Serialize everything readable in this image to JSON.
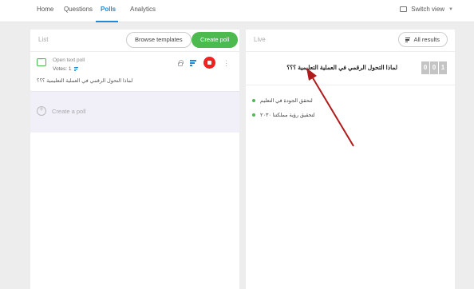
{
  "nav": {
    "tabs": [
      "Home",
      "Questions",
      "Polls",
      "Analytics"
    ],
    "active": "Polls",
    "switch_view": "Switch view"
  },
  "list_panel": {
    "title": "List",
    "browse_templates": "Browse templates",
    "create_poll": "Create poll",
    "poll": {
      "type": "Open text poll",
      "votes": "Votes: 1",
      "question": "لماذا التحول الرقمي في العملية التعليمية ؟؟؟"
    },
    "create_row_label": "Create a poll"
  },
  "live_panel": {
    "title": "Live",
    "all_results": "All results",
    "question": "لماذا التحول الرقمي في العملية التعليمية ؟؟؟",
    "counter": [
      "0",
      "0",
      "1"
    ],
    "options": [
      "لتحقق الجودة في التعليم",
      "لتحقيق رؤية مملكتنا ٢٠٣٠"
    ]
  },
  "colors": {
    "accent": "#1f88d8",
    "green": "#4cba4f",
    "stop": "#e22222",
    "annotation_arrow": "#b11a1a"
  }
}
